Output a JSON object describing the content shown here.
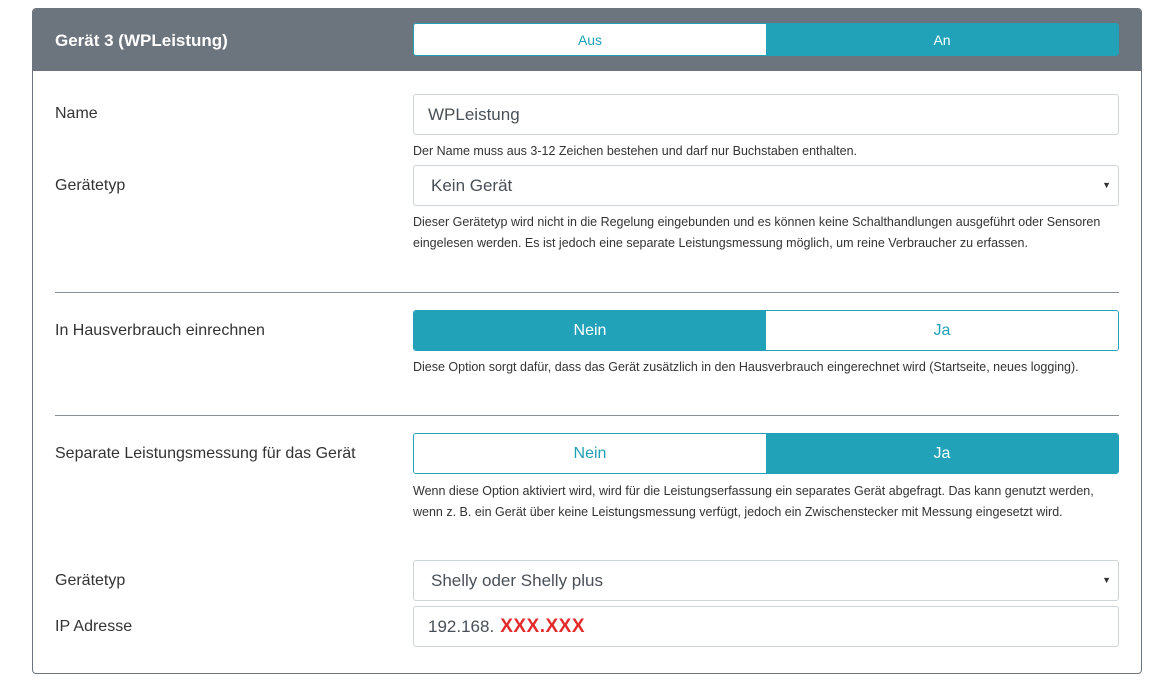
{
  "header": {
    "title": "Gerät 3 (WPLeistung)",
    "toggle": {
      "off_label": "Aus",
      "on_label": "An",
      "selected": "An"
    }
  },
  "name": {
    "label": "Name",
    "value": "WPLeistung",
    "help": "Der Name muss aus 3-12 Zeichen bestehen und darf nur Buchstaben enthalten."
  },
  "device_type": {
    "label": "Gerätetyp",
    "selected": "Kein Gerät",
    "help": "Dieser Gerätetyp wird nicht in die Regelung eingebunden und es können keine Schalthandlungen ausgeführt oder Sensoren eingelesen werden. Es ist jedoch eine separate Leistungsmessung möglich, um reine Verbraucher zu erfassen."
  },
  "house_consumption": {
    "label": "In Hausverbrauch einrechnen",
    "no_label": "Nein",
    "yes_label": "Ja",
    "selected": "Nein",
    "help": "Diese Option sorgt dafür, dass das Gerät zusätzlich in den Hausverbrauch eingerechnet wird (Startseite, neues logging)."
  },
  "separate_measurement": {
    "label": "Separate Leistungsmessung für das Gerät",
    "no_label": "Nein",
    "yes_label": "Ja",
    "selected": "Ja",
    "help": "Wenn diese Option aktiviert wird, wird für die Leistungserfassung ein separates Gerät abgefragt. Das kann genutzt werden, wenn z. B. ein Gerät über keine Leistungsmessung verfügt, jedoch ein Zwischenstecker mit Messung eingesetzt wird."
  },
  "meter_type": {
    "label": "Gerätetyp",
    "selected": "Shelly oder Shelly plus"
  },
  "ip_address": {
    "label": "IP Adresse",
    "value_prefix": "192.168.",
    "value_redacted": "XXX.XXX"
  },
  "colors": {
    "header_bg": "#6c757d",
    "accent": "#22a2b8",
    "redaction": "#e32b2b"
  },
  "icons": {
    "select_caret": "caret-down-icon"
  }
}
